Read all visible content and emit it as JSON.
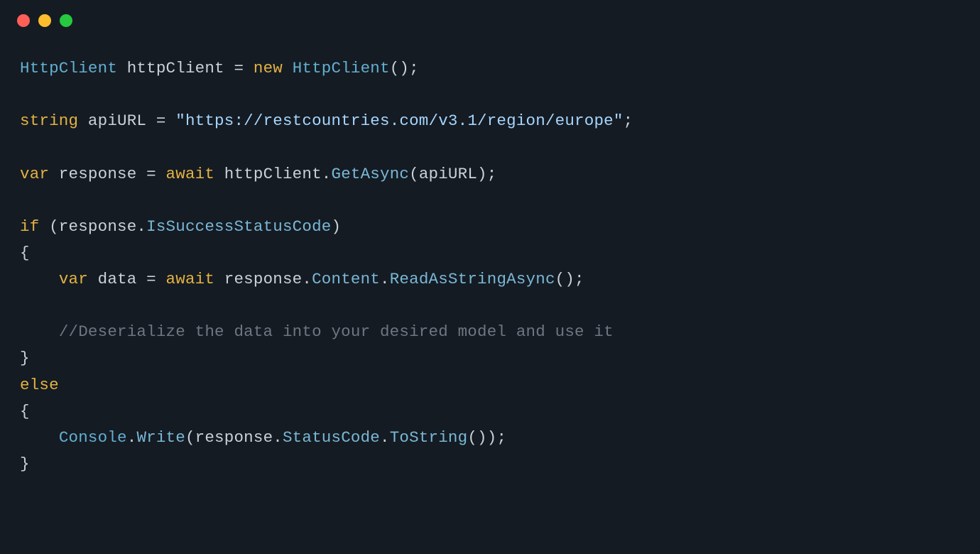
{
  "titlebar": {
    "dots": [
      "red",
      "yellow",
      "green"
    ]
  },
  "code": {
    "line1": {
      "t1": "HttpClient",
      "t2": " httpClient ",
      "t3": "=",
      "t4": " ",
      "t5": "new",
      "t6": " ",
      "t7": "HttpClient",
      "t8": "();"
    },
    "line2": "",
    "line3": {
      "t1": "string",
      "t2": " apiURL ",
      "t3": "=",
      "t4": " ",
      "t5": "\"https://restcountries.com/v3.1/region/europe\"",
      "t6": ";"
    },
    "line4": "",
    "line5": {
      "t1": "var",
      "t2": " response ",
      "t3": "=",
      "t4": " ",
      "t5": "await",
      "t6": " httpClient.",
      "t7": "GetAsync",
      "t8": "(apiURL);"
    },
    "line6": "",
    "line7": {
      "t1": "if",
      "t2": " (response.",
      "t3": "IsSuccessStatusCode",
      "t4": ")"
    },
    "line8": "{",
    "line9": {
      "indent": "    ",
      "t1": "var",
      "t2": " data ",
      "t3": "=",
      "t4": " ",
      "t5": "await",
      "t6": " response.",
      "t7": "Content",
      "t8": ".",
      "t9": "ReadAsStringAsync",
      "t10": "();"
    },
    "line10": "",
    "line11": {
      "indent": "    ",
      "t1": "//Deserialize the data into your desired model and use it"
    },
    "line12": "}",
    "line13": {
      "t1": "else"
    },
    "line14": "{",
    "line15": {
      "indent": "    ",
      "t1": "Console",
      "t2": ".",
      "t3": "Write",
      "t4": "(response.",
      "t5": "StatusCode",
      "t6": ".",
      "t7": "ToString",
      "t8": "());"
    },
    "line16": "}"
  }
}
